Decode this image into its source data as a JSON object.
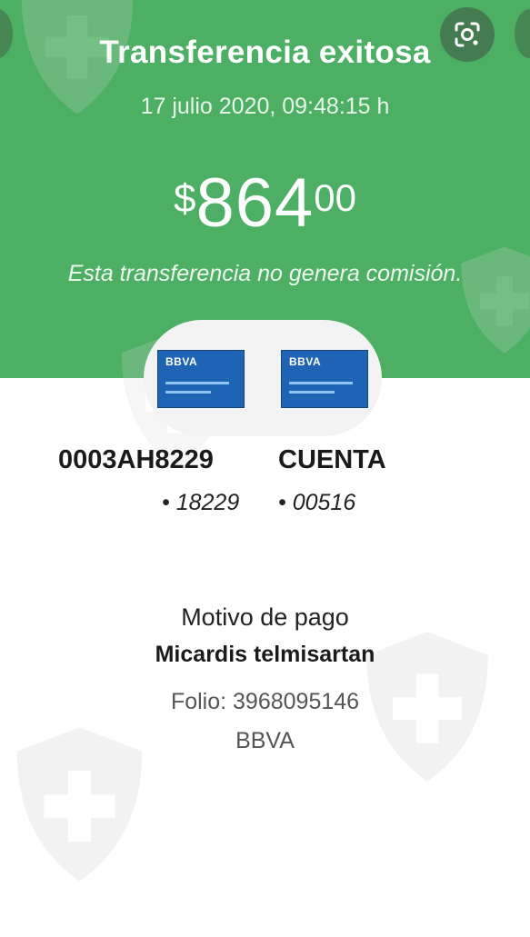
{
  "header": {
    "title": "Transferencia exitosa",
    "datetime": "17 julio 2020, 09:48:15 h",
    "amount": {
      "currency": "$",
      "integer": "864",
      "decimals": "00"
    },
    "note": "Esta transferencia no genera comisión."
  },
  "lens_icon": "google-lens-icon",
  "origin": {
    "card_brand": "BBVA",
    "name": "0003AH8229",
    "number": "• 18229"
  },
  "destination": {
    "card_brand": "BBVA",
    "name": "CUENTA",
    "number": "• 00516"
  },
  "details": {
    "motivo_label": "Motivo de pago",
    "motivo_value": "Micardis telmisartan",
    "folio": "Folio: 3968095146",
    "bank": "BBVA"
  },
  "colors": {
    "header_green": "#4caf63",
    "card_blue": "#1f64b4"
  }
}
